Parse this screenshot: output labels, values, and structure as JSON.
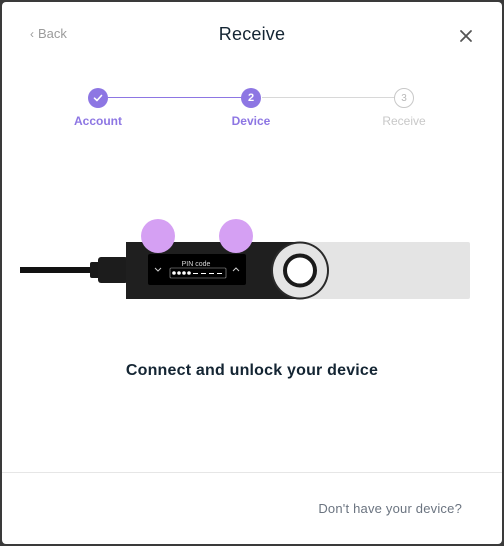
{
  "header": {
    "back_label": "Back",
    "title": "Receive"
  },
  "stepper": {
    "steps": [
      {
        "number": "1",
        "label": "Account",
        "state": "done"
      },
      {
        "number": "2",
        "label": "Device",
        "state": "active"
      },
      {
        "number": "3",
        "label": "Receive",
        "state": "upcoming"
      }
    ],
    "accent_color": "#8d76e3"
  },
  "device": {
    "screen_text": "PIN code"
  },
  "main": {
    "headline": "Connect and unlock your device"
  },
  "footer": {
    "link_label": "Don't have your device?"
  }
}
